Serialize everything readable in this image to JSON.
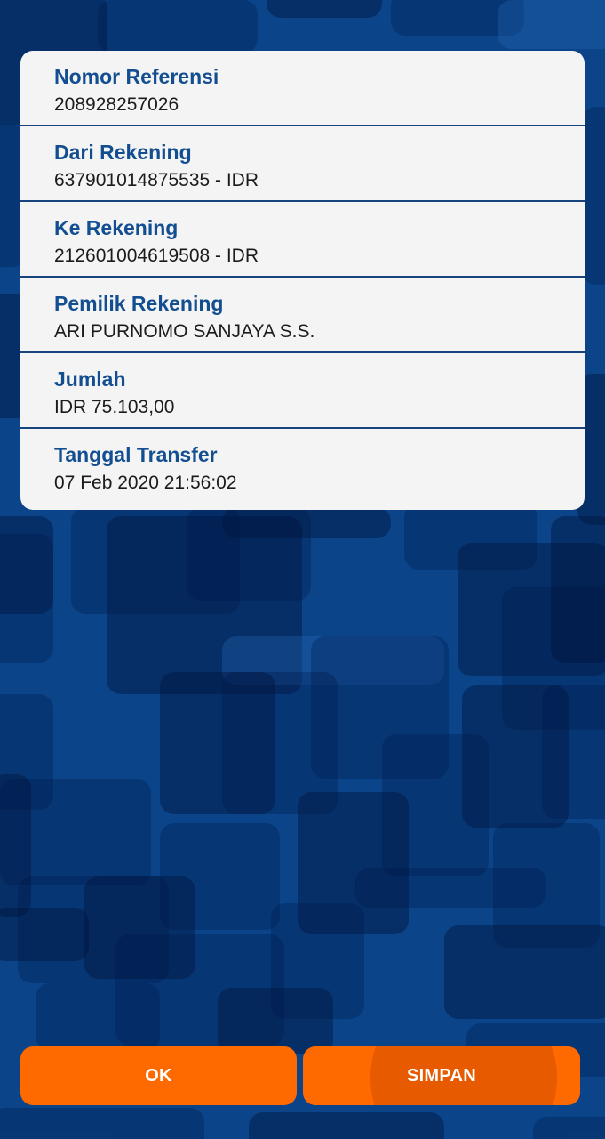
{
  "details": {
    "items": [
      {
        "label": "Nomor Referensi",
        "value": "208928257026"
      },
      {
        "label": "Dari Rekening",
        "value": "637901014875535 - IDR"
      },
      {
        "label": "Ke Rekening",
        "value": "212601004619508 - IDR"
      },
      {
        "label": "Pemilik Rekening",
        "value": "ARI PURNOMO SANJAYA S.S."
      },
      {
        "label": "Jumlah",
        "value": "IDR 75.103,00"
      },
      {
        "label": "Tanggal Transfer",
        "value": "07 Feb 2020 21:56:02"
      }
    ]
  },
  "buttons": {
    "ok_label": "OK",
    "save_label": "SIMPAN"
  },
  "colors": {
    "background": "#0b4489",
    "card": "#f4f4f4",
    "label_text": "#134e91",
    "divider": "#16457e",
    "button": "#ff6a00"
  }
}
